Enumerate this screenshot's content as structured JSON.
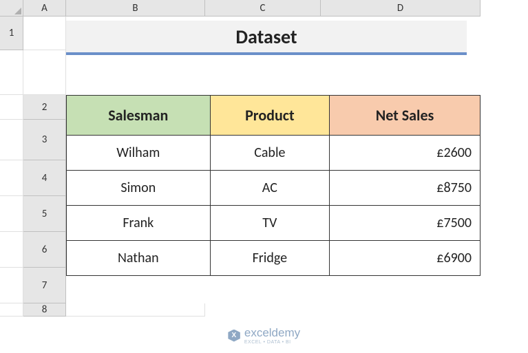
{
  "columns": [
    "A",
    "B",
    "C",
    "D"
  ],
  "rows": [
    "1",
    "2",
    "3",
    "4",
    "5",
    "6",
    "7",
    "8"
  ],
  "title": "Dataset",
  "table": {
    "headers": {
      "salesman": "Salesman",
      "product": "Product",
      "netsales": "Net Sales"
    },
    "data": [
      {
        "salesman": "Wilham",
        "product": "Cable",
        "netsales": "£2600"
      },
      {
        "salesman": "Simon",
        "product": "AC",
        "netsales": "£8750"
      },
      {
        "salesman": "Frank",
        "product": "TV",
        "netsales": "£7500"
      },
      {
        "salesman": "Nathan",
        "product": "Fridge",
        "netsales": "£6900"
      }
    ]
  },
  "watermark": {
    "brand": "exceldemy",
    "tagline": "EXCEL • DATA • BI"
  }
}
